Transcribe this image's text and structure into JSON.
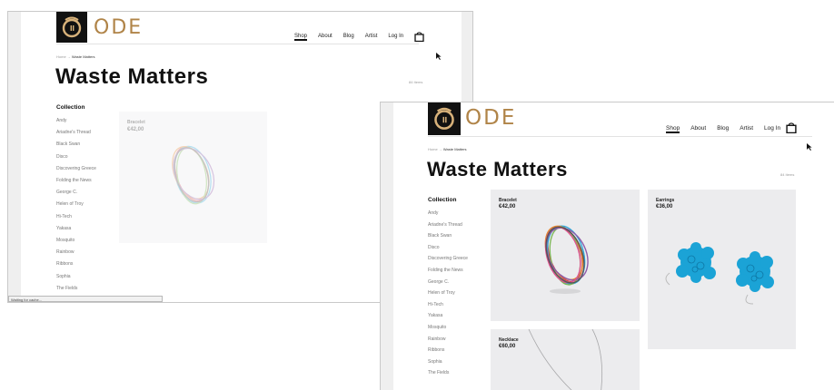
{
  "brand": {
    "logo_text": "ODE",
    "brand_color": "#b08448"
  },
  "nav": {
    "shop": "Shop",
    "about": "About",
    "blog": "Blog",
    "artist": "Artist",
    "login": "Log In",
    "cart_icon": "shopping-bag-icon"
  },
  "breadcrumb": {
    "home": "Home",
    "sep": "→",
    "current": "Waste Matters"
  },
  "page": {
    "title": "Waste Matters",
    "count": "84 Items"
  },
  "collection": {
    "heading": "Collection",
    "items": [
      "Andy",
      "Ariadne's Thread",
      "Black Swan",
      "Disco",
      "Discovering Greece",
      "Folding the News",
      "George C.",
      "Helen of Troy",
      "Hi-Tech",
      "Yakasa",
      "Mosquito",
      "Rainbow",
      "Ribbons",
      "Sophia",
      "The Fields"
    ]
  },
  "products": [
    {
      "name": "Bracelet",
      "price": "€42,00"
    },
    {
      "name": "Earrings",
      "price": "€36,00"
    },
    {
      "name": "Necklace",
      "price": "€60,00"
    }
  ],
  "status": {
    "text": "Waiting for cache..."
  },
  "colors": {
    "accent": "#b08448",
    "earring": "#1ba3d6",
    "card_bg": "#ececee"
  }
}
